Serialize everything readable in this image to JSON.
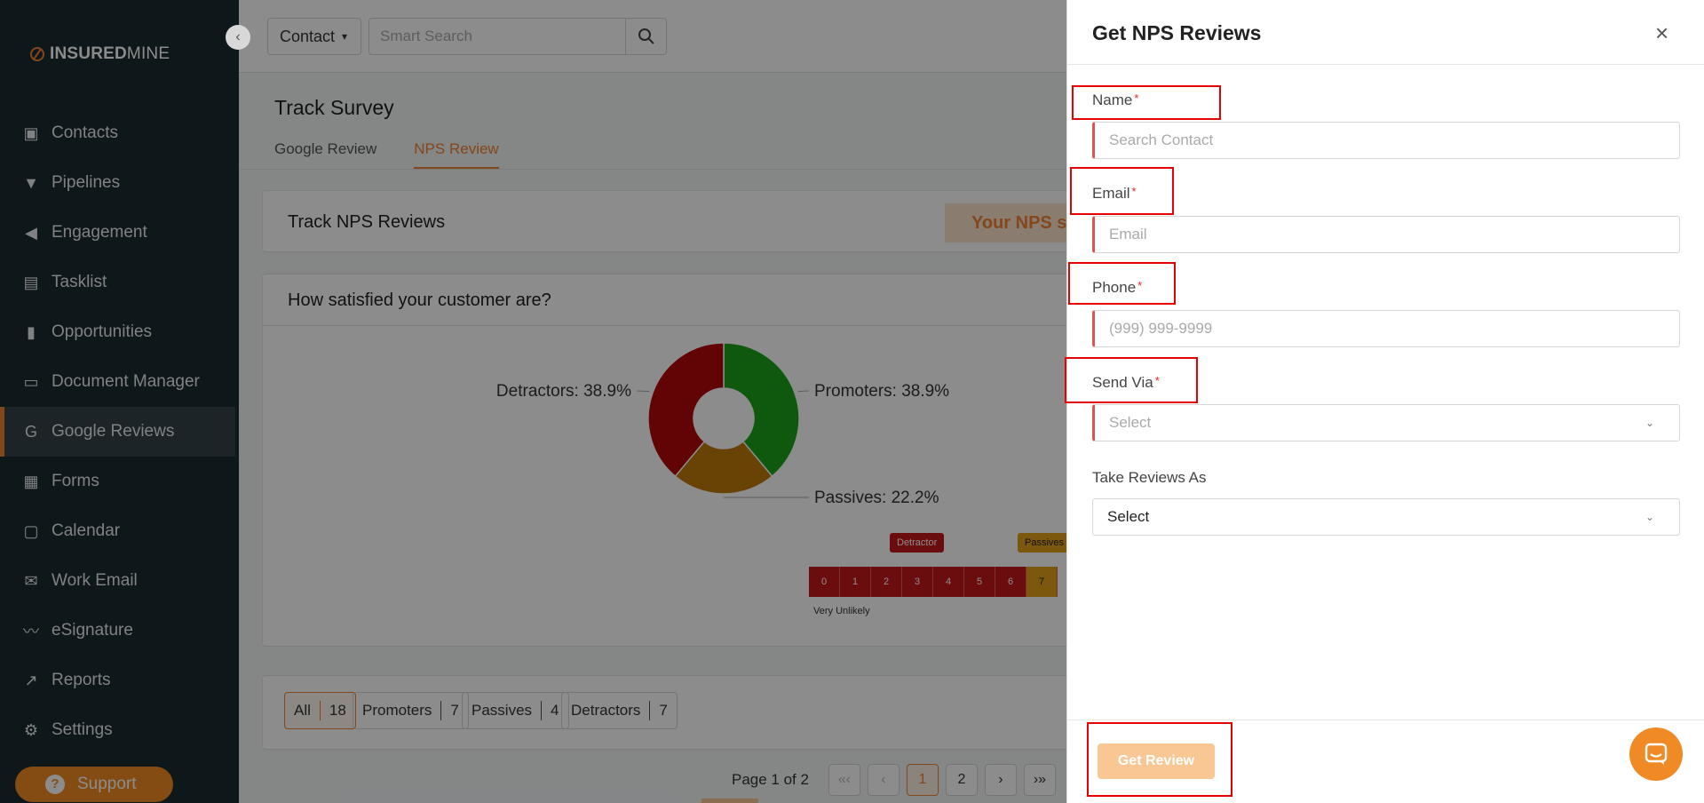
{
  "app": {
    "logo_bold": "INSURED",
    "logo_light": "MINE",
    "collapse_glyph": "‹"
  },
  "sidebar": {
    "items": [
      {
        "label": "Contacts",
        "icon": "contact-card-icon",
        "glyph": "▣"
      },
      {
        "label": "Pipelines",
        "icon": "funnel-icon",
        "glyph": "▼"
      },
      {
        "label": "Engagement",
        "icon": "megaphone-icon",
        "glyph": "◀"
      },
      {
        "label": "Tasklist",
        "icon": "tasklist-icon",
        "glyph": "▤"
      },
      {
        "label": "Opportunities",
        "icon": "bar-people-icon",
        "glyph": "▮"
      },
      {
        "label": "Document Manager",
        "icon": "folder-icon",
        "glyph": "▭"
      },
      {
        "label": "Google Reviews",
        "icon": "google-icon",
        "glyph": "G"
      },
      {
        "label": "Forms",
        "icon": "form-icon",
        "glyph": "▦"
      },
      {
        "label": "Calendar",
        "icon": "calendar-icon",
        "glyph": "▢"
      },
      {
        "label": "Work Email",
        "icon": "envelope-icon",
        "glyph": "✉"
      },
      {
        "label": "eSignature",
        "icon": "signature-icon",
        "glyph": "〰"
      },
      {
        "label": "Reports",
        "icon": "line-chart-icon",
        "glyph": "↗"
      },
      {
        "label": "Settings",
        "icon": "gear-icon",
        "glyph": "⚙"
      }
    ],
    "active_index": 6,
    "support_label": "Support",
    "support_glyph": "?"
  },
  "topbar": {
    "contact_select": "Contact",
    "search_placeholder": "Smart Search"
  },
  "page": {
    "title": "Track Survey",
    "tabs": [
      "Google Review",
      "NPS Review"
    ],
    "active_tab": 1
  },
  "nps_card": {
    "title": "Track NPS Reviews",
    "score_text": "Your NPS score"
  },
  "satisfaction": {
    "title": "How satisfied your customer are?"
  },
  "chart_data": {
    "type": "pie",
    "donut": true,
    "slices": [
      {
        "label": "Promoters",
        "value": 38.9,
        "display": "Promoters: 38.9%",
        "color": "#1aa31a"
      },
      {
        "label": "Passives",
        "value": 22.2,
        "display": "Passives: 22.2%",
        "color": "#bf7a0a"
      },
      {
        "label": "Detractors",
        "value": 38.9,
        "display": "Detractors: 38.9%",
        "color": "#b3060b"
      }
    ]
  },
  "scale": {
    "cells": [
      "0",
      "1",
      "2",
      "3",
      "4",
      "5",
      "6",
      "7"
    ],
    "detractor_tip": "Detractor",
    "passives_tip": "Passives",
    "low_label": "Very Unlikely"
  },
  "filters": [
    {
      "label": "All",
      "count": "18",
      "active": true
    },
    {
      "label": "Promoters",
      "count": "7",
      "active": false
    },
    {
      "label": "Passives",
      "count": "4",
      "active": false
    },
    {
      "label": "Detractors",
      "count": "7",
      "active": false
    }
  ],
  "pager": {
    "text": "Page 1 of 2",
    "first": "«‹",
    "prev": "‹",
    "pages": [
      "1",
      "2"
    ],
    "next": "›",
    "last": "›»"
  },
  "drawer": {
    "title": "Get NPS Reviews",
    "close_glyph": "×",
    "name_label": "Name",
    "name_placeholder": "Search Contact",
    "email_label": "Email",
    "email_placeholder": "Email",
    "phone_label": "Phone",
    "phone_placeholder": "(999) 999-9999",
    "send_via_label": "Send Via",
    "send_via_value": "Select",
    "take_reviews_label": "Take Reviews As",
    "take_reviews_value": "Select",
    "required_mark": "*",
    "submit_label": "Get Review"
  },
  "colors": {
    "accent": "#f08232",
    "sidebar_bg": "#1b2a30",
    "highlight_box": "#e60000"
  }
}
